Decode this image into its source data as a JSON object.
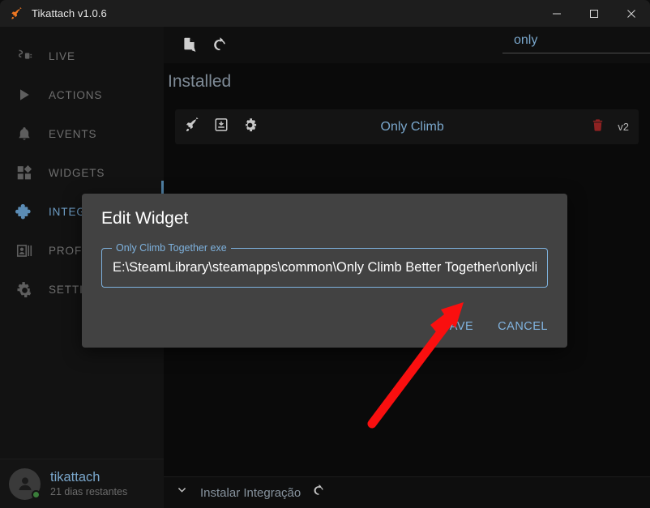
{
  "window": {
    "title": "Tikattach v1.0.6",
    "app_icon": "rocket-icon",
    "minimize_label": "—",
    "maximize_label": "□",
    "close_label": "✕"
  },
  "sidebar": {
    "items": [
      {
        "label": "LIVE",
        "icon": "plug-icon",
        "active": false
      },
      {
        "label": "ACTIONS",
        "icon": "play-icon",
        "active": false
      },
      {
        "label": "EVENTS",
        "icon": "bell-icon",
        "active": false
      },
      {
        "label": "WIDGETS",
        "icon": "widgets-icon",
        "active": false
      },
      {
        "label": "INTEGRATIONS",
        "icon": "puzzle-icon",
        "active": true
      },
      {
        "label": "PROFILES",
        "icon": "profile-icon",
        "active": false
      },
      {
        "label": "SETTINGS",
        "icon": "gear-icon",
        "active": false
      }
    ],
    "user": {
      "name": "tikattach",
      "status": "21 dias restantes",
      "avatar_icon": "user-avatar-icon",
      "status_dot_color": "#3a7d3a"
    }
  },
  "toolbar": {
    "import_icon": "file-import-icon",
    "refresh_icon": "refresh-icon"
  },
  "search": {
    "value": "only",
    "placeholder": ""
  },
  "main": {
    "section_title": "Installed",
    "widgets": [
      {
        "name": "Only Climb",
        "version": "v2",
        "launch_icon": "rocket-icon",
        "install_icon": "download-box-icon",
        "settings_icon": "gear-icon",
        "delete_icon": "trash-icon"
      }
    ]
  },
  "footer": {
    "expand_icon": "chevron-down-icon",
    "label": "Instalar Integração",
    "refresh_icon": "refresh-icon"
  },
  "modal": {
    "title": "Edit Widget",
    "field_label": "Only Climb Together exe",
    "field_value": "E:\\SteamLibrary\\steamapps\\common\\Only Climb Better Together\\onlyclim",
    "save_label": "SAVE",
    "cancel_label": "CANCEL"
  },
  "annotation": {
    "arrow_color": "#fa0f0f",
    "arrow_target": "save-button"
  },
  "colors": {
    "accent_blue": "#7aa7cc",
    "modal_bg": "#424242",
    "field_border": "#7eb2de",
    "danger_red": "#8f2222",
    "app_icon_orange": "#ee7722"
  }
}
